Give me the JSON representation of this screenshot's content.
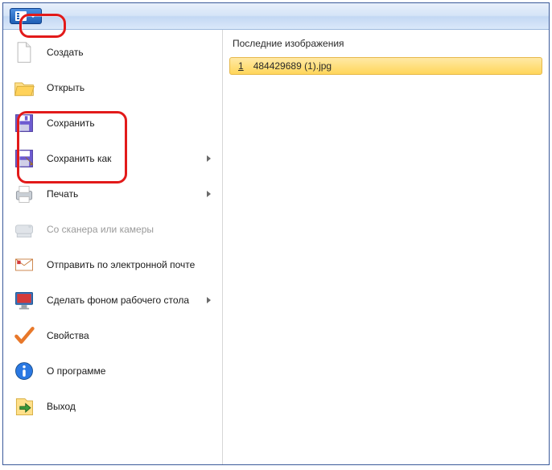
{
  "menu": {
    "new": "Создать",
    "open": "Открыть",
    "save": "Сохранить",
    "save_as": "Сохранить как",
    "print": "Печать",
    "scanner": "Со сканера или камеры",
    "send_email": "Отправить по электронной почте",
    "set_wallpaper": "Сделать фоном рабочего стола",
    "properties": "Свойства",
    "about": "О программе",
    "exit": "Выход"
  },
  "right": {
    "header": "Последние изображения",
    "recent": [
      {
        "num": "1",
        "name": "484429689 (1).jpg"
      }
    ]
  }
}
